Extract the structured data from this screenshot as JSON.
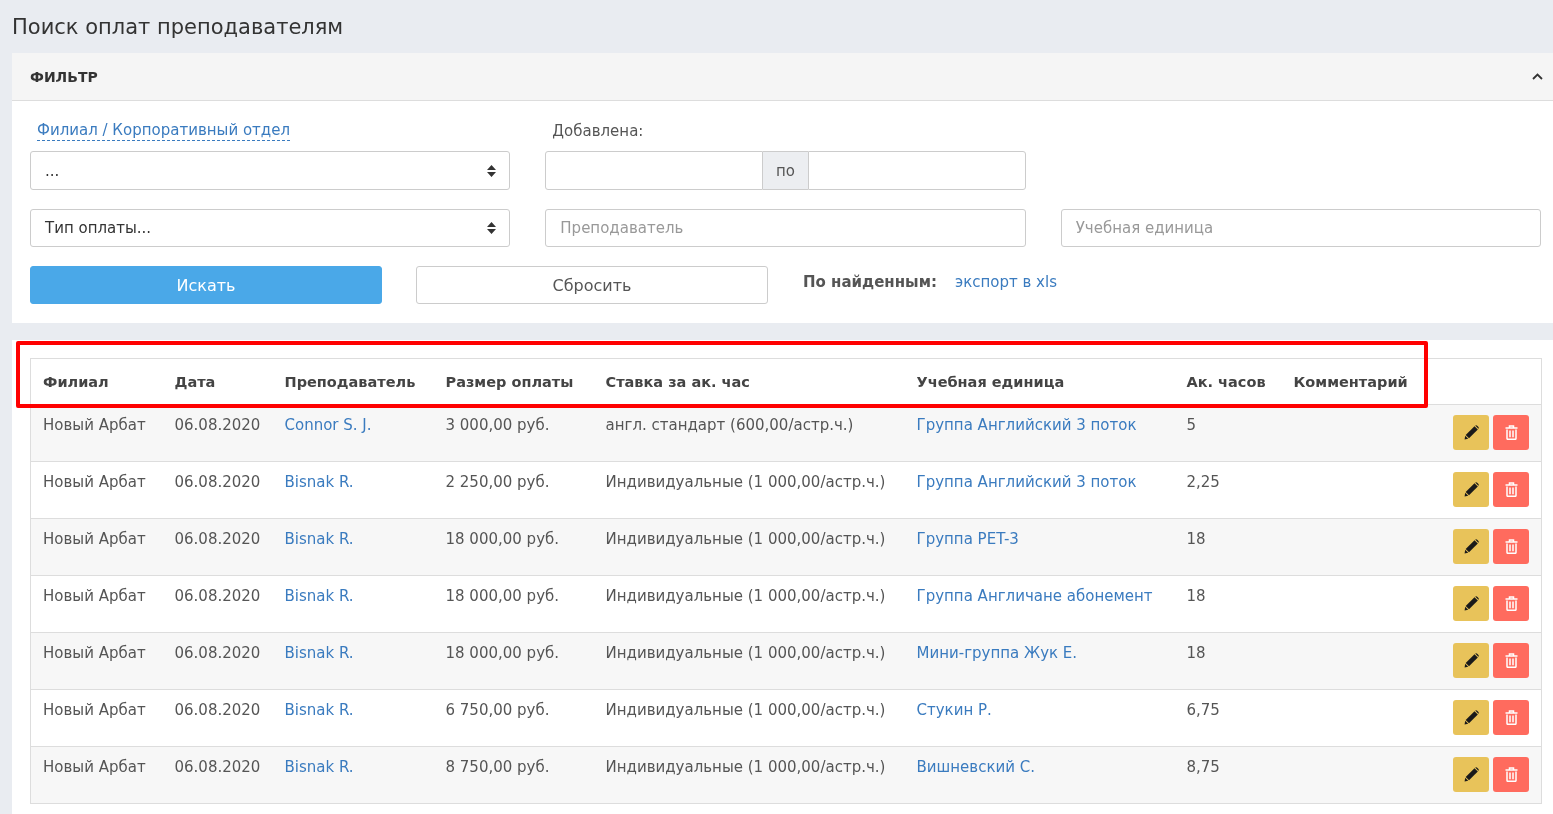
{
  "page_title": "Поиск оплат преподавателям",
  "filter": {
    "title": "ФИЛЬТР",
    "expanded": true,
    "branch_label": "Филиал / Корпоративный отдел",
    "branch_select": {
      "value": "..."
    },
    "added_label": "Добавлена:",
    "added_range": {
      "separator": "по"
    },
    "payment_type_select": {
      "value": "Тип оплаты..."
    },
    "teacher_field": {
      "placeholder": "Преподаватель"
    },
    "unit_field": {
      "placeholder": "Учебная единица"
    },
    "search_button": "Искать",
    "reset_button": "Сбросить",
    "found_label": "По найденным:",
    "export_link": "экспорт в xls"
  },
  "table": {
    "columns": [
      "Филиал",
      "Дата",
      "Преподаватель",
      "Размер оплаты",
      "Ставка за ак. час",
      "Учебная единица",
      "Ак. часов",
      "Комментарий"
    ],
    "rows": [
      {
        "branch": "Новый Арбат",
        "date": "06.08.2020",
        "teacher": "Connor S. J.",
        "amount": "3 000,00 руб.",
        "rate": "англ. стандарт (600,00/астр.ч.)",
        "unit": "Группа Английский 3 поток",
        "hours": "5"
      },
      {
        "branch": "Новый Арбат",
        "date": "06.08.2020",
        "teacher": "Bisnak R.",
        "amount": "2 250,00 руб.",
        "rate": "Индивидуальные (1 000,00/астр.ч.)",
        "unit": "Группа Английский 3 поток",
        "hours": "2,25"
      },
      {
        "branch": "Новый Арбат",
        "date": "06.08.2020",
        "teacher": "Bisnak R.",
        "amount": "18 000,00 руб.",
        "rate": "Индивидуальные (1 000,00/астр.ч.)",
        "unit": "Группа PET-3",
        "hours": "18"
      },
      {
        "branch": "Новый Арбат",
        "date": "06.08.2020",
        "teacher": "Bisnak R.",
        "amount": "18 000,00 руб.",
        "rate": "Индивидуальные (1 000,00/астр.ч.)",
        "unit": "Группа Англичане абонемент",
        "hours": "18"
      },
      {
        "branch": "Новый Арбат",
        "date": "06.08.2020",
        "teacher": "Bisnak R.",
        "amount": "18 000,00 руб.",
        "rate": "Индивидуальные (1 000,00/астр.ч.)",
        "unit": "Мини-группа Жук Е.",
        "hours": "18"
      },
      {
        "branch": "Новый Арбат",
        "date": "06.08.2020",
        "teacher": "Bisnak R.",
        "amount": "6 750,00 руб.",
        "rate": "Индивидуальные (1 000,00/астр.ч.)",
        "unit": "Стукин Р.",
        "hours": "6,75"
      },
      {
        "branch": "Новый Арбат",
        "date": "06.08.2020",
        "teacher": "Bisnak R.",
        "amount": "8 750,00 руб.",
        "rate": "Индивидуальные (1 000,00/астр.ч.)",
        "unit": "Вишневский С.",
        "hours": "8,75"
      }
    ]
  }
}
